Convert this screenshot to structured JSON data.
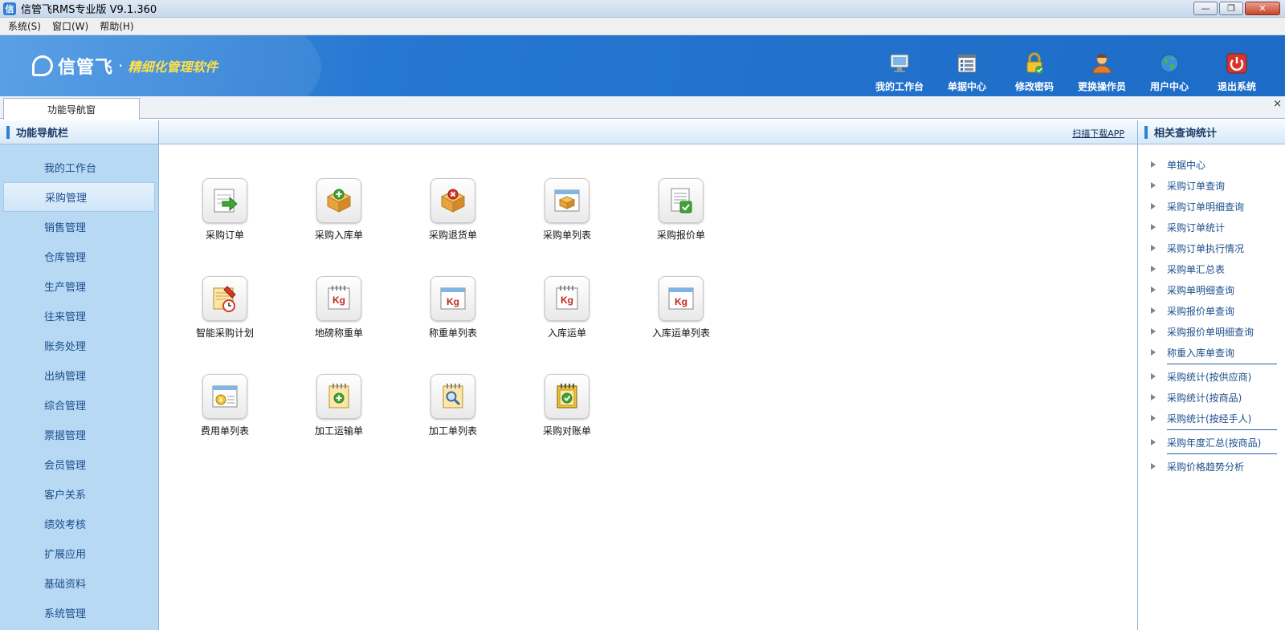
{
  "window": {
    "title": "信管飞RMS专业版 V9.1.360",
    "controls": [
      "—",
      "❐",
      "✕"
    ]
  },
  "menu": [
    "系统(S)",
    "窗口(W)",
    "帮助(H)"
  ],
  "brand": {
    "name": "信管飞",
    "dot": "·",
    "slogan": "精细化管理软件"
  },
  "toolbar": [
    {
      "label": "我的工作台",
      "icon": "monitor-icon"
    },
    {
      "label": "单据中心",
      "icon": "list-icon"
    },
    {
      "label": "修改密码",
      "icon": "lock-icon"
    },
    {
      "label": "更换操作员",
      "icon": "user-icon"
    },
    {
      "label": "用户中心",
      "icon": "globe-icon"
    },
    {
      "label": "退出系统",
      "icon": "power-icon"
    }
  ],
  "tabs": {
    "active": "功能导航窗",
    "close": "×"
  },
  "left_nav": {
    "title": "功能导航栏",
    "items": [
      "我的工作台",
      "采购管理",
      "销售管理",
      "仓库管理",
      "生产管理",
      "往来管理",
      "账务处理",
      "出纳管理",
      "综合管理",
      "票据管理",
      "会员管理",
      "客户关系",
      "绩效考核",
      "扩展应用",
      "基础资料",
      "系统管理"
    ],
    "active_index": 1
  },
  "center": {
    "scan_link": "扫描下载APP",
    "items": [
      {
        "label": "采购订单",
        "icon": "order-arrow-icon"
      },
      {
        "label": "采购入库单",
        "icon": "box-add-icon"
      },
      {
        "label": "采购退货单",
        "icon": "box-remove-icon"
      },
      {
        "label": "采购单列表",
        "icon": "box-list-icon"
      },
      {
        "label": "采购报价单",
        "icon": "doc-check-icon"
      },
      {
        "label": "智能采购计划",
        "icon": "plan-clock-icon"
      },
      {
        "label": "地磅称重单",
        "icon": "kg-icon"
      },
      {
        "label": "称重单列表",
        "icon": "kg-list-icon"
      },
      {
        "label": "入库运单",
        "icon": "kg-icon"
      },
      {
        "label": "入库运单列表",
        "icon": "kg-list-icon"
      },
      {
        "label": "费用单列表",
        "icon": "cost-list-icon"
      },
      {
        "label": "加工运输单",
        "icon": "notepad-add-icon"
      },
      {
        "label": "加工单列表",
        "icon": "notepad-search-icon"
      },
      {
        "label": "采购对账单",
        "icon": "notepad-check-icon"
      }
    ],
    "kg_text": "Kg"
  },
  "right_panel": {
    "title": "相关查询统计",
    "groups": [
      [
        "单据中心",
        "采购订单查询",
        "采购订单明细查询",
        "采购订单统计",
        "采购订单执行情况",
        "采购单汇总表",
        "采购单明细查询",
        "采购报价单查询",
        "采购报价单明细查询",
        "称重入库单查询"
      ],
      [
        "采购统计(按供应商)",
        "采购统计(按商品)",
        "采购统计(按经手人)"
      ],
      [
        "采购年度汇总(按商品)"
      ],
      [
        "采购价格趋势分析"
      ]
    ]
  },
  "colors": {
    "banner": "#2677d1",
    "nav_bg": "#b7d9f4",
    "link": "#1d4e8c",
    "slogan": "#ffe04a"
  }
}
